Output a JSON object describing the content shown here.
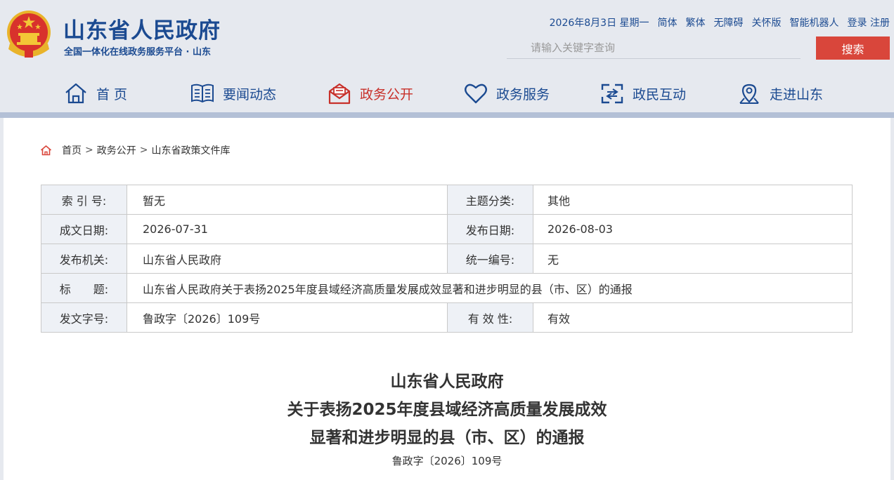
{
  "header": {
    "site_title": "山东省人民政府",
    "site_subtitle": "全国一体化在线政务服务平台 · 山东",
    "date": "2026年8月3日 星期一",
    "links": [
      "简体",
      "繁体",
      "无障碍",
      "关怀版",
      "智能机器人",
      "登录",
      "注册"
    ],
    "search_placeholder": "请输入关键字查询",
    "search_button": "搜索"
  },
  "nav": [
    {
      "label": "首 页",
      "icon": "home-icon"
    },
    {
      "label": "要闻动态",
      "icon": "news-icon"
    },
    {
      "label": "政务公开",
      "icon": "mail-icon",
      "active": true
    },
    {
      "label": "政务服务",
      "icon": "heart-icon"
    },
    {
      "label": "政民互动",
      "icon": "interaction-icon"
    },
    {
      "label": "走进山东",
      "icon": "location-icon"
    }
  ],
  "breadcrumb": [
    "首页",
    "政务公开",
    "山东省政策文件库"
  ],
  "meta": {
    "index_label": "索 引 号:",
    "index_value": "暂无",
    "topic_label": "主题分类:",
    "topic_value": "其他",
    "written_label": "成文日期:",
    "written_value": "2026-07-31",
    "published_label": "发布日期:",
    "published_value": "2026-08-03",
    "issuer_label": "发布机关:",
    "issuer_value": "山东省人民政府",
    "serial_label": "统一编号:",
    "serial_value": "无",
    "title_label": "标　　题:",
    "title_value": "山东省人民政府关于表扬2025年度县域经济高质量发展成效显著和进步明显的县（市、区）的通报",
    "docno_label": "发文字号:",
    "docno_value": "鲁政字〔2026〕109号",
    "validity_label": "有 效 性:",
    "validity_value": "有效"
  },
  "document": {
    "title_lines": [
      "山东省人民政府",
      "关于表扬2025年度县域经济高质量发展成效",
      "显著和进步明显的县（市、区）的通报"
    ],
    "doc_number": "鲁政字〔2026〕109号"
  },
  "colors": {
    "brand": "#1b4a91",
    "accent": "#d9463b",
    "nav_active": "#c8302a"
  }
}
